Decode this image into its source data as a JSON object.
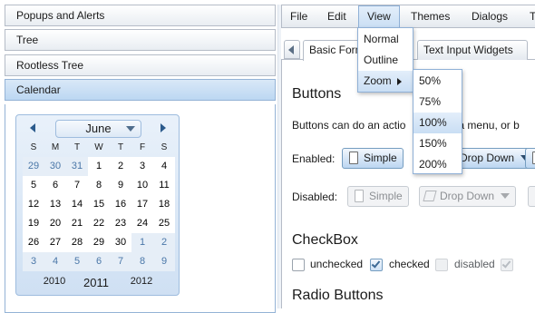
{
  "accordion": {
    "panels": [
      {
        "label": "Popups and Alerts"
      },
      {
        "label": "Tree"
      },
      {
        "label": "Rootless Tree"
      },
      {
        "label": "Calendar"
      }
    ]
  },
  "calendar": {
    "month": "June",
    "weekdays": [
      "S",
      "M",
      "T",
      "W",
      "T",
      "F",
      "S"
    ],
    "weeks": [
      [
        "29",
        "30",
        "31",
        "1",
        "2",
        "3",
        "4"
      ],
      [
        "5",
        "6",
        "7",
        "8",
        "9",
        "10",
        "11"
      ],
      [
        "12",
        "13",
        "14",
        "15",
        "16",
        "17",
        "18"
      ],
      [
        "19",
        "20",
        "21",
        "22",
        "23",
        "24",
        "25"
      ],
      [
        "26",
        "27",
        "28",
        "29",
        "30",
        "1",
        "2"
      ],
      [
        "3",
        "4",
        "5",
        "6",
        "7",
        "8",
        "9"
      ]
    ],
    "years": {
      "previous": "2010",
      "current": "2011",
      "next": "2012"
    }
  },
  "menubar": {
    "items": [
      {
        "label": "File"
      },
      {
        "label": "Edit"
      },
      {
        "label": "View"
      },
      {
        "label": "Themes"
      },
      {
        "label": "Dialogs"
      },
      {
        "label": "T"
      }
    ]
  },
  "view_menu": {
    "items": [
      {
        "label": "Normal"
      },
      {
        "label": "Outline"
      },
      {
        "label": "Zoom"
      }
    ]
  },
  "zoom_submenu": {
    "items": [
      {
        "label": "50%"
      },
      {
        "label": "75%"
      },
      {
        "label": "100%"
      },
      {
        "label": "150%"
      },
      {
        "label": "200%"
      }
    ],
    "highlighted": "100%"
  },
  "tabs": {
    "items": [
      {
        "label": "Basic Form"
      },
      {
        "label": "Text Input Widgets"
      }
    ]
  },
  "content": {
    "buttons_heading": "Buttons",
    "buttons_intro_a": "Buttons can do an actio",
    "buttons_intro_b": "a menu, or b",
    "enabled_label": "Enabled:",
    "disabled_label": "Disabled:",
    "simple_label": "Simple",
    "drop_down_label": "Drop Down",
    "checkbox_heading": "CheckBox",
    "checkboxes": [
      {
        "label": "unchecked",
        "checked": false,
        "disabled": false
      },
      {
        "label": "checked",
        "checked": true,
        "disabled": false
      },
      {
        "label": "disabled",
        "checked": false,
        "disabled": true
      },
      {
        "label": "",
        "checked": true,
        "disabled": true
      }
    ],
    "radio_heading": "Radio Buttons"
  },
  "colors": {
    "accent": "#759dc0",
    "active_header": "#bcd7f2",
    "other_month_text": "#4a77a8"
  }
}
